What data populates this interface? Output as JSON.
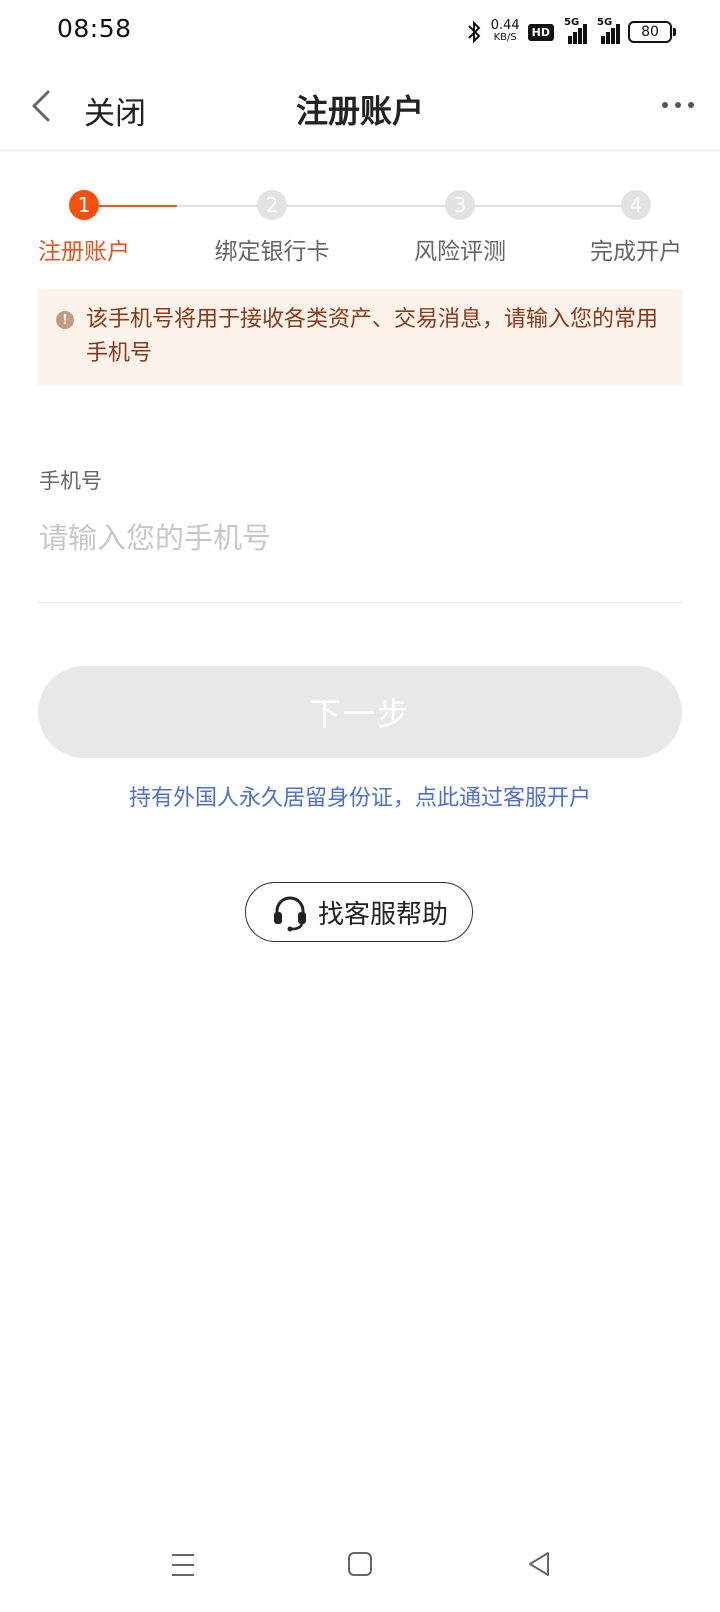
{
  "status_bar": {
    "time": "08:58",
    "net_speed": "0.44",
    "net_speed_unit": "KB/S",
    "hd_badge": "HD",
    "signal_1_label": "5G",
    "signal_2_label": "5G",
    "battery": "80"
  },
  "nav": {
    "close_label": "关闭",
    "title": "注册账户"
  },
  "steps": [
    {
      "number": "1",
      "label": "注册账户",
      "active": true
    },
    {
      "number": "2",
      "label": "绑定银行卡",
      "active": false
    },
    {
      "number": "3",
      "label": "风险评测",
      "active": false
    },
    {
      "number": "4",
      "label": "完成开户",
      "active": false
    }
  ],
  "notice": {
    "text": "该手机号将用于接收各类资产、交易消息，请输入您的常用手机号"
  },
  "phone_field": {
    "label": "手机号",
    "placeholder": "请输入您的手机号",
    "value": ""
  },
  "next_button": {
    "label": "下一步"
  },
  "foreign_link": {
    "text": "持有外国人永久居留身份证，点此通过客服开户"
  },
  "help_button": {
    "label": "找客服帮助"
  },
  "colors": {
    "accent": "#f6500f",
    "link": "#4f6fd6",
    "notice_bg": "#fdf3eb",
    "notice_text": "#8a3a1a"
  }
}
